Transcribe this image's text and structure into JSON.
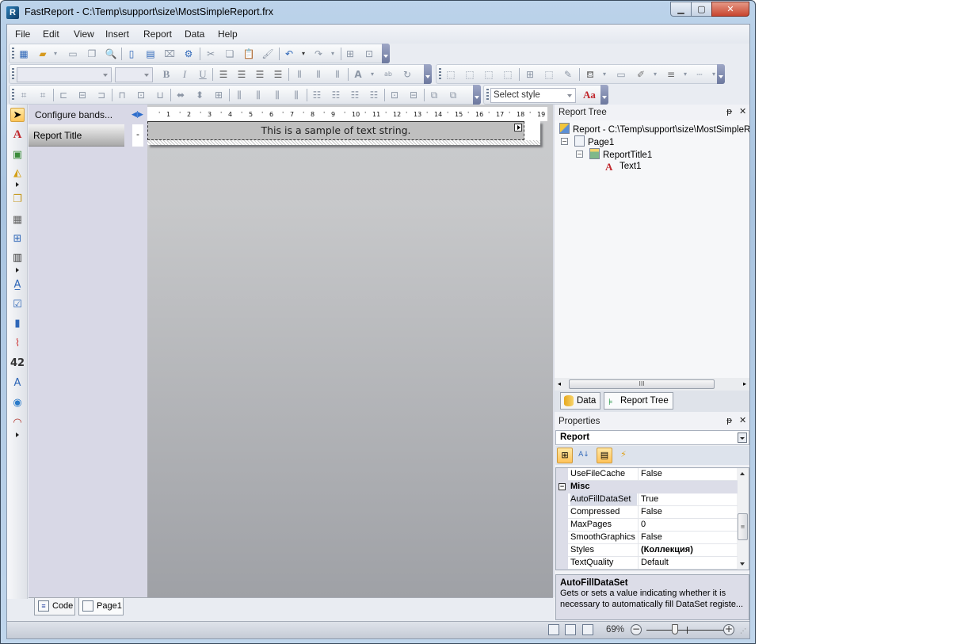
{
  "window": {
    "title": "FastReport - C:\\Temp\\support\\size\\MostSimpleReport.frx",
    "app_icon_letter": "R",
    "controls": {
      "minimize": "▁",
      "maximize": "▢",
      "close": "✕"
    }
  },
  "menu": [
    "File",
    "Edit",
    "View",
    "Insert",
    "Report",
    "Data",
    "Help"
  ],
  "toolbars": {
    "standard": [
      "new-report",
      "open",
      "save",
      "save-all",
      "preview",
      "new-page",
      "new-dialog",
      "delete-page",
      "page-setup",
      "cut",
      "copy",
      "paste",
      "format-painter",
      "undo",
      "redo",
      "group",
      "ungroup"
    ],
    "text": {
      "font_name": "",
      "font_size": "",
      "buttons": [
        "bold",
        "italic",
        "underline",
        "align-left",
        "align-center",
        "align-right",
        "justify",
        "align-top",
        "align-middle",
        "align-bottom",
        "font-color",
        "highlight",
        "rotate"
      ],
      "bold_glyph": "B",
      "italic_glyph": "I",
      "underline_glyph": "U"
    },
    "border": [
      "top-line",
      "bottom-line",
      "left-line",
      "right-line",
      "all-lines",
      "no-lines",
      "border-editor",
      "fill-color",
      "fill-editor",
      "line-color",
      "line-width",
      "line-style"
    ],
    "layout": [
      "align-to-grid",
      "fit-to-grid",
      "align-lefts",
      "align-centers",
      "align-rights",
      "align-tops",
      "align-middles",
      "align-bottoms",
      "same-width",
      "same-height",
      "same-size",
      "space-horz",
      "increase-horz",
      "decrease-horz",
      "remove-horz",
      "space-vert",
      "increase-vert",
      "decrease-vert",
      "remove-vert",
      "center-horz",
      "center-vert",
      "bring-front",
      "send-back"
    ],
    "style": {
      "placeholder": "Select style",
      "style_editor_glyph": "Aa"
    }
  },
  "objects_toolbar": [
    "pointer",
    "text",
    "picture",
    "shapes",
    "subreport",
    "table",
    "matrix",
    "barcode",
    "rich-text",
    "checkbox",
    "chart",
    "sparkline",
    "zip-code",
    "cellular-text",
    "map",
    "gauge"
  ],
  "bands": {
    "configure_label": "Configure bands...",
    "items": [
      {
        "label": "Report Title",
        "collapse": "-"
      }
    ]
  },
  "designer": {
    "ruler_ticks": [
      "1",
      "2",
      "3",
      "4",
      "5",
      "6",
      "7",
      "8",
      "9",
      "10",
      "11",
      "12",
      "13",
      "14",
      "15",
      "16",
      "17",
      "18",
      "19"
    ],
    "sample_text": "This is a sample of text string."
  },
  "page_tabs": [
    {
      "label": "Code",
      "icon": "code-icon"
    },
    {
      "label": "Page1",
      "icon": "page-icon",
      "active": true
    }
  ],
  "status": {
    "zoom_label": "69%",
    "zoom_fraction": 0.35,
    "zoom_minus": "−",
    "zoom_plus": "+"
  },
  "report_tree": {
    "title": "Report Tree",
    "pin": "ᵽ",
    "close": "✕",
    "nodes": [
      {
        "label": "Report - C:\\Temp\\support\\size\\MostSimpleReport.frx",
        "level": 0,
        "icon": "report-icon"
      },
      {
        "label": "Page1",
        "level": 1,
        "icon": "page-icon"
      },
      {
        "label": "ReportTitle1",
        "level": 2,
        "icon": "band-icon"
      },
      {
        "label": "Text1",
        "level": 3,
        "icon": "text-icon"
      }
    ],
    "scroll_grip": "III",
    "dock_tabs": [
      {
        "label": "Data",
        "icon": "database-icon"
      },
      {
        "label": "Report Tree",
        "icon": "tree-icon",
        "active": true
      }
    ]
  },
  "properties": {
    "title": "Properties",
    "pin": "ᵽ",
    "close": "✕",
    "selected_object": "Report",
    "rows": [
      {
        "name": "UseFileCache",
        "value": "False"
      },
      {
        "category": "Misc",
        "toggle": "−"
      },
      {
        "name": "AutoFillDataSet",
        "value": "True",
        "selected": true
      },
      {
        "name": "Compressed",
        "value": "False"
      },
      {
        "name": "MaxPages",
        "value": "0"
      },
      {
        "name": "SmoothGraphics",
        "value": "False"
      },
      {
        "name": "Styles",
        "value": "(Коллекция)",
        "bold": true
      },
      {
        "name": "TextQuality",
        "value": "Default"
      }
    ],
    "description": {
      "title": "AutoFillDataSet",
      "line1": "Gets or sets a value indicating whether it is",
      "line2": "necessary to automatically fill DataSet registe..."
    }
  }
}
